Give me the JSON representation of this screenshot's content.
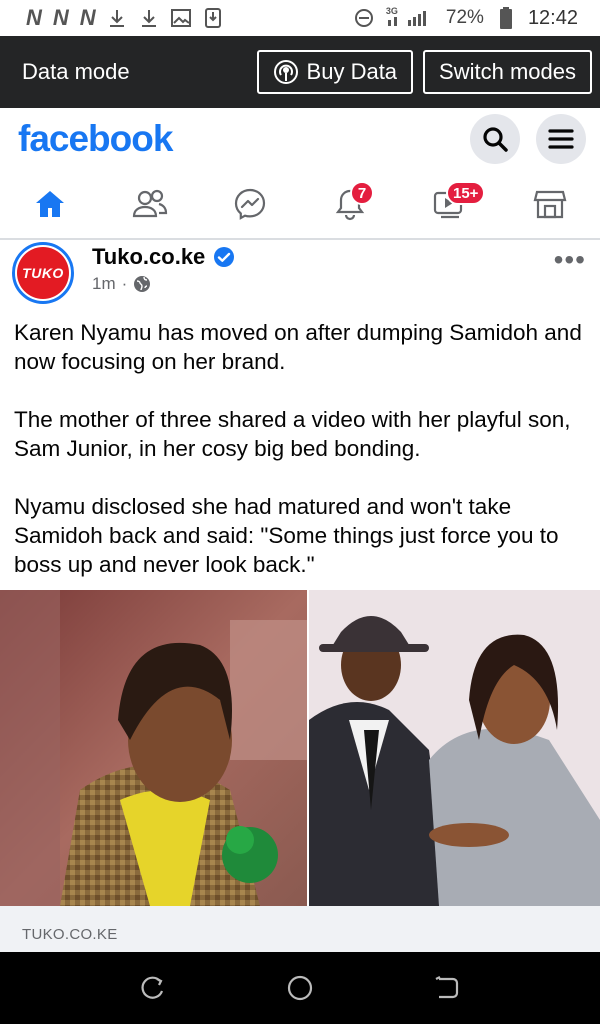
{
  "status_bar": {
    "carrier_marks": [
      "N",
      "N",
      "N"
    ],
    "network_type": "3G",
    "battery": "72%",
    "time": "12:42"
  },
  "data_bar": {
    "title": "Data mode",
    "buy_data": "Buy Data",
    "switch_modes": "Switch modes"
  },
  "header": {
    "logo": "facebook"
  },
  "nav": {
    "notifications_badge": "7",
    "video_badge": "15+",
    "accent": "#1877f2"
  },
  "post": {
    "page_name": "Tuko.co.ke",
    "avatar_text": "TUKO",
    "time": "1m",
    "dot": "·",
    "paragraphs": [
      "Karen Nyamu has moved on after dumping Samidoh and now focusing on her brand.",
      "The mother of three shared a video with her playful son, Sam Junior, in her cosy big bed bonding.",
      "Nyamu disclosed she had matured and won't take Samidoh back and said: \"Some things just force you to boss up and never look back.\""
    ],
    "link_domain": "TUKO.CO.KE"
  }
}
